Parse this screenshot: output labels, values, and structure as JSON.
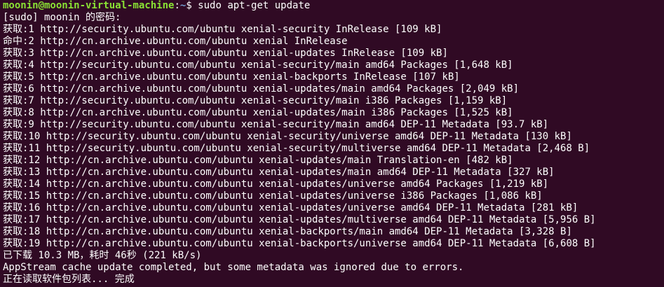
{
  "terminal": {
    "prompt": {
      "user_host": "moonin@moonin-virtual-machine",
      "colon": ":",
      "path": "~",
      "symbol": "$ ",
      "command": "sudo apt-get update"
    },
    "lines": [
      "[sudo] moonin 的密码:",
      "获取:1 http://security.ubuntu.com/ubuntu xenial-security InRelease [109 kB]",
      "命中:2 http://cn.archive.ubuntu.com/ubuntu xenial InRelease",
      "获取:3 http://cn.archive.ubuntu.com/ubuntu xenial-updates InRelease [109 kB]",
      "获取:4 http://security.ubuntu.com/ubuntu xenial-security/main amd64 Packages [1,648 kB]",
      "获取:5 http://cn.archive.ubuntu.com/ubuntu xenial-backports InRelease [107 kB]",
      "获取:6 http://cn.archive.ubuntu.com/ubuntu xenial-updates/main amd64 Packages [2,049 kB]",
      "获取:7 http://security.ubuntu.com/ubuntu xenial-security/main i386 Packages [1,159 kB]",
      "获取:8 http://cn.archive.ubuntu.com/ubuntu xenial-updates/main i386 Packages [1,525 kB]",
      "获取:9 http://security.ubuntu.com/ubuntu xenial-security/main amd64 DEP-11 Metadata [93.7 kB]",
      "获取:10 http://security.ubuntu.com/ubuntu xenial-security/universe amd64 DEP-11 Metadata [130 kB]",
      "获取:11 http://security.ubuntu.com/ubuntu xenial-security/multiverse amd64 DEP-11 Metadata [2,468 B]",
      "获取:12 http://cn.archive.ubuntu.com/ubuntu xenial-updates/main Translation-en [482 kB]",
      "获取:13 http://cn.archive.ubuntu.com/ubuntu xenial-updates/main amd64 DEP-11 Metadata [327 kB]",
      "获取:14 http://cn.archive.ubuntu.com/ubuntu xenial-updates/universe amd64 Packages [1,219 kB]",
      "获取:15 http://cn.archive.ubuntu.com/ubuntu xenial-updates/universe i386 Packages [1,086 kB]",
      "获取:16 http://cn.archive.ubuntu.com/ubuntu xenial-updates/universe amd64 DEP-11 Metadata [281 kB]",
      "获取:17 http://cn.archive.ubuntu.com/ubuntu xenial-updates/multiverse amd64 DEP-11 Metadata [5,956 B]",
      "获取:18 http://cn.archive.ubuntu.com/ubuntu xenial-backports/main amd64 DEP-11 Metadata [3,328 B]",
      "获取:19 http://cn.archive.ubuntu.com/ubuntu xenial-backports/universe amd64 DEP-11 Metadata [6,608 B]",
      "已下载 10.3 MB，耗时 46秒 (221 kB/s)",
      "AppStream cache update completed, but some metadata was ignored due to errors.",
      "正在读取软件包列表... 完成"
    ]
  },
  "colors": {
    "background": "#300a24",
    "text": "#ffffff",
    "prompt_user": "#8ae234",
    "prompt_path": "#729fcf"
  }
}
